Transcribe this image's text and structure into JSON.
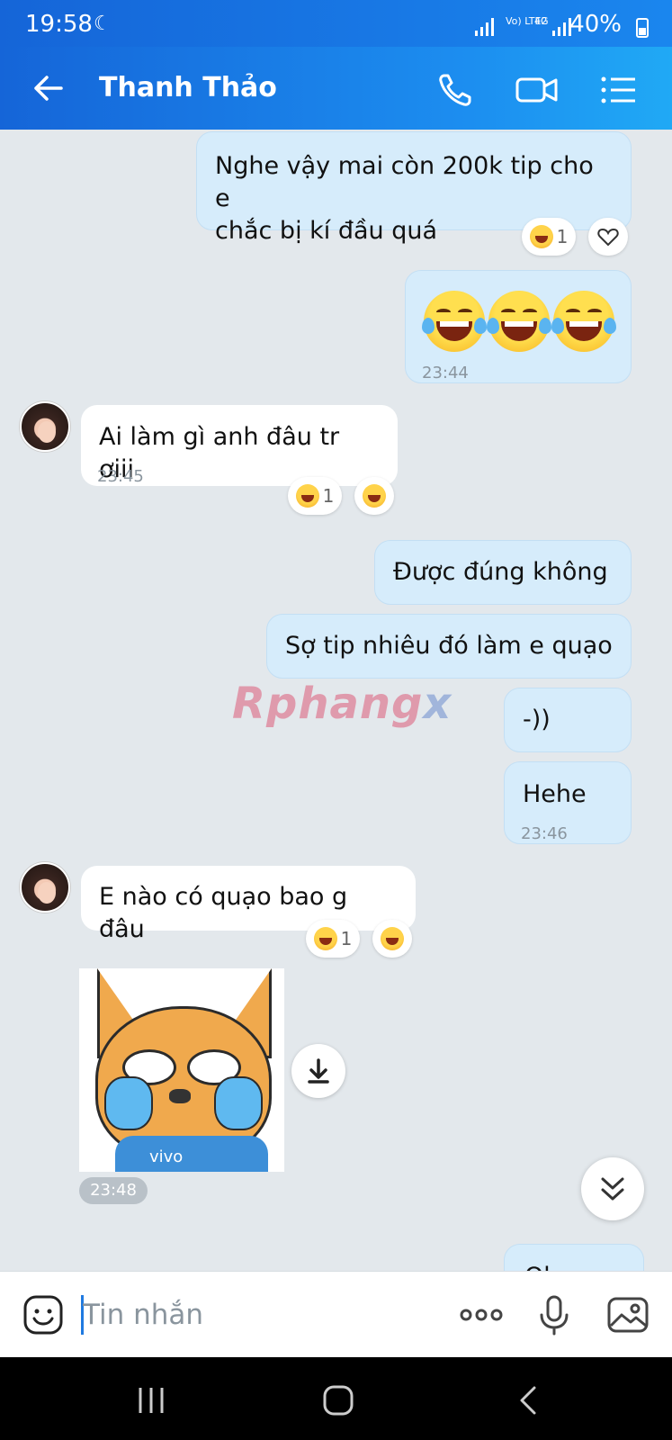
{
  "status_bar": {
    "time": "19:58",
    "lte_label": "Vo) LTE2",
    "net_label": "4G",
    "battery": "40%"
  },
  "header": {
    "title": "Thanh Thảo"
  },
  "watermark": {
    "part1": "Rphang",
    "part2": "x"
  },
  "messages": [
    {
      "id": "m1",
      "direction": "out",
      "lines": [
        "Nghe vậy mai còn 200k tip cho e",
        "chắc bị kí đầu quá"
      ]
    },
    {
      "id": "m2",
      "direction": "out",
      "time": "23:44"
    },
    {
      "id": "m3",
      "direction": "in",
      "text": "Ai làm gì anh đâu tr ơiii",
      "time": "23:45"
    },
    {
      "id": "m4",
      "direction": "out",
      "text": "Được đúng không"
    },
    {
      "id": "m5",
      "direction": "out",
      "text": "Sợ tip nhiêu đó làm e quạo"
    },
    {
      "id": "m6",
      "direction": "out",
      "text": "-))"
    },
    {
      "id": "m7",
      "direction": "out",
      "text": "Hehe",
      "time": "23:46"
    },
    {
      "id": "m8",
      "direction": "in",
      "text": "E nào có quạo bao g đâu"
    },
    {
      "id": "m9",
      "direction": "in",
      "type": "sticker",
      "sticker_text": "vivo",
      "time": "23:48"
    },
    {
      "id": "m10",
      "direction": "out",
      "text": "Ok..."
    }
  ],
  "reactions": {
    "count_m1": "1",
    "count_m3": "1",
    "count_m8": "1"
  },
  "input": {
    "placeholder": "Tin nhắn"
  },
  "colors": {
    "header_start": "#1565d8",
    "header_end": "#20a9f5",
    "bubble_out": "#d6ecfb",
    "bubble_in": "#ffffff",
    "chat_bg": "#e3e8ec"
  },
  "icons": [
    "back-arrow-icon",
    "phone-icon",
    "video-call-icon",
    "list-menu-icon",
    "sticker-icon",
    "more-dots-icon",
    "microphone-icon",
    "image-icon",
    "download-icon",
    "scroll-down-icon",
    "recents-icon",
    "home-icon",
    "nav-back-icon"
  ]
}
